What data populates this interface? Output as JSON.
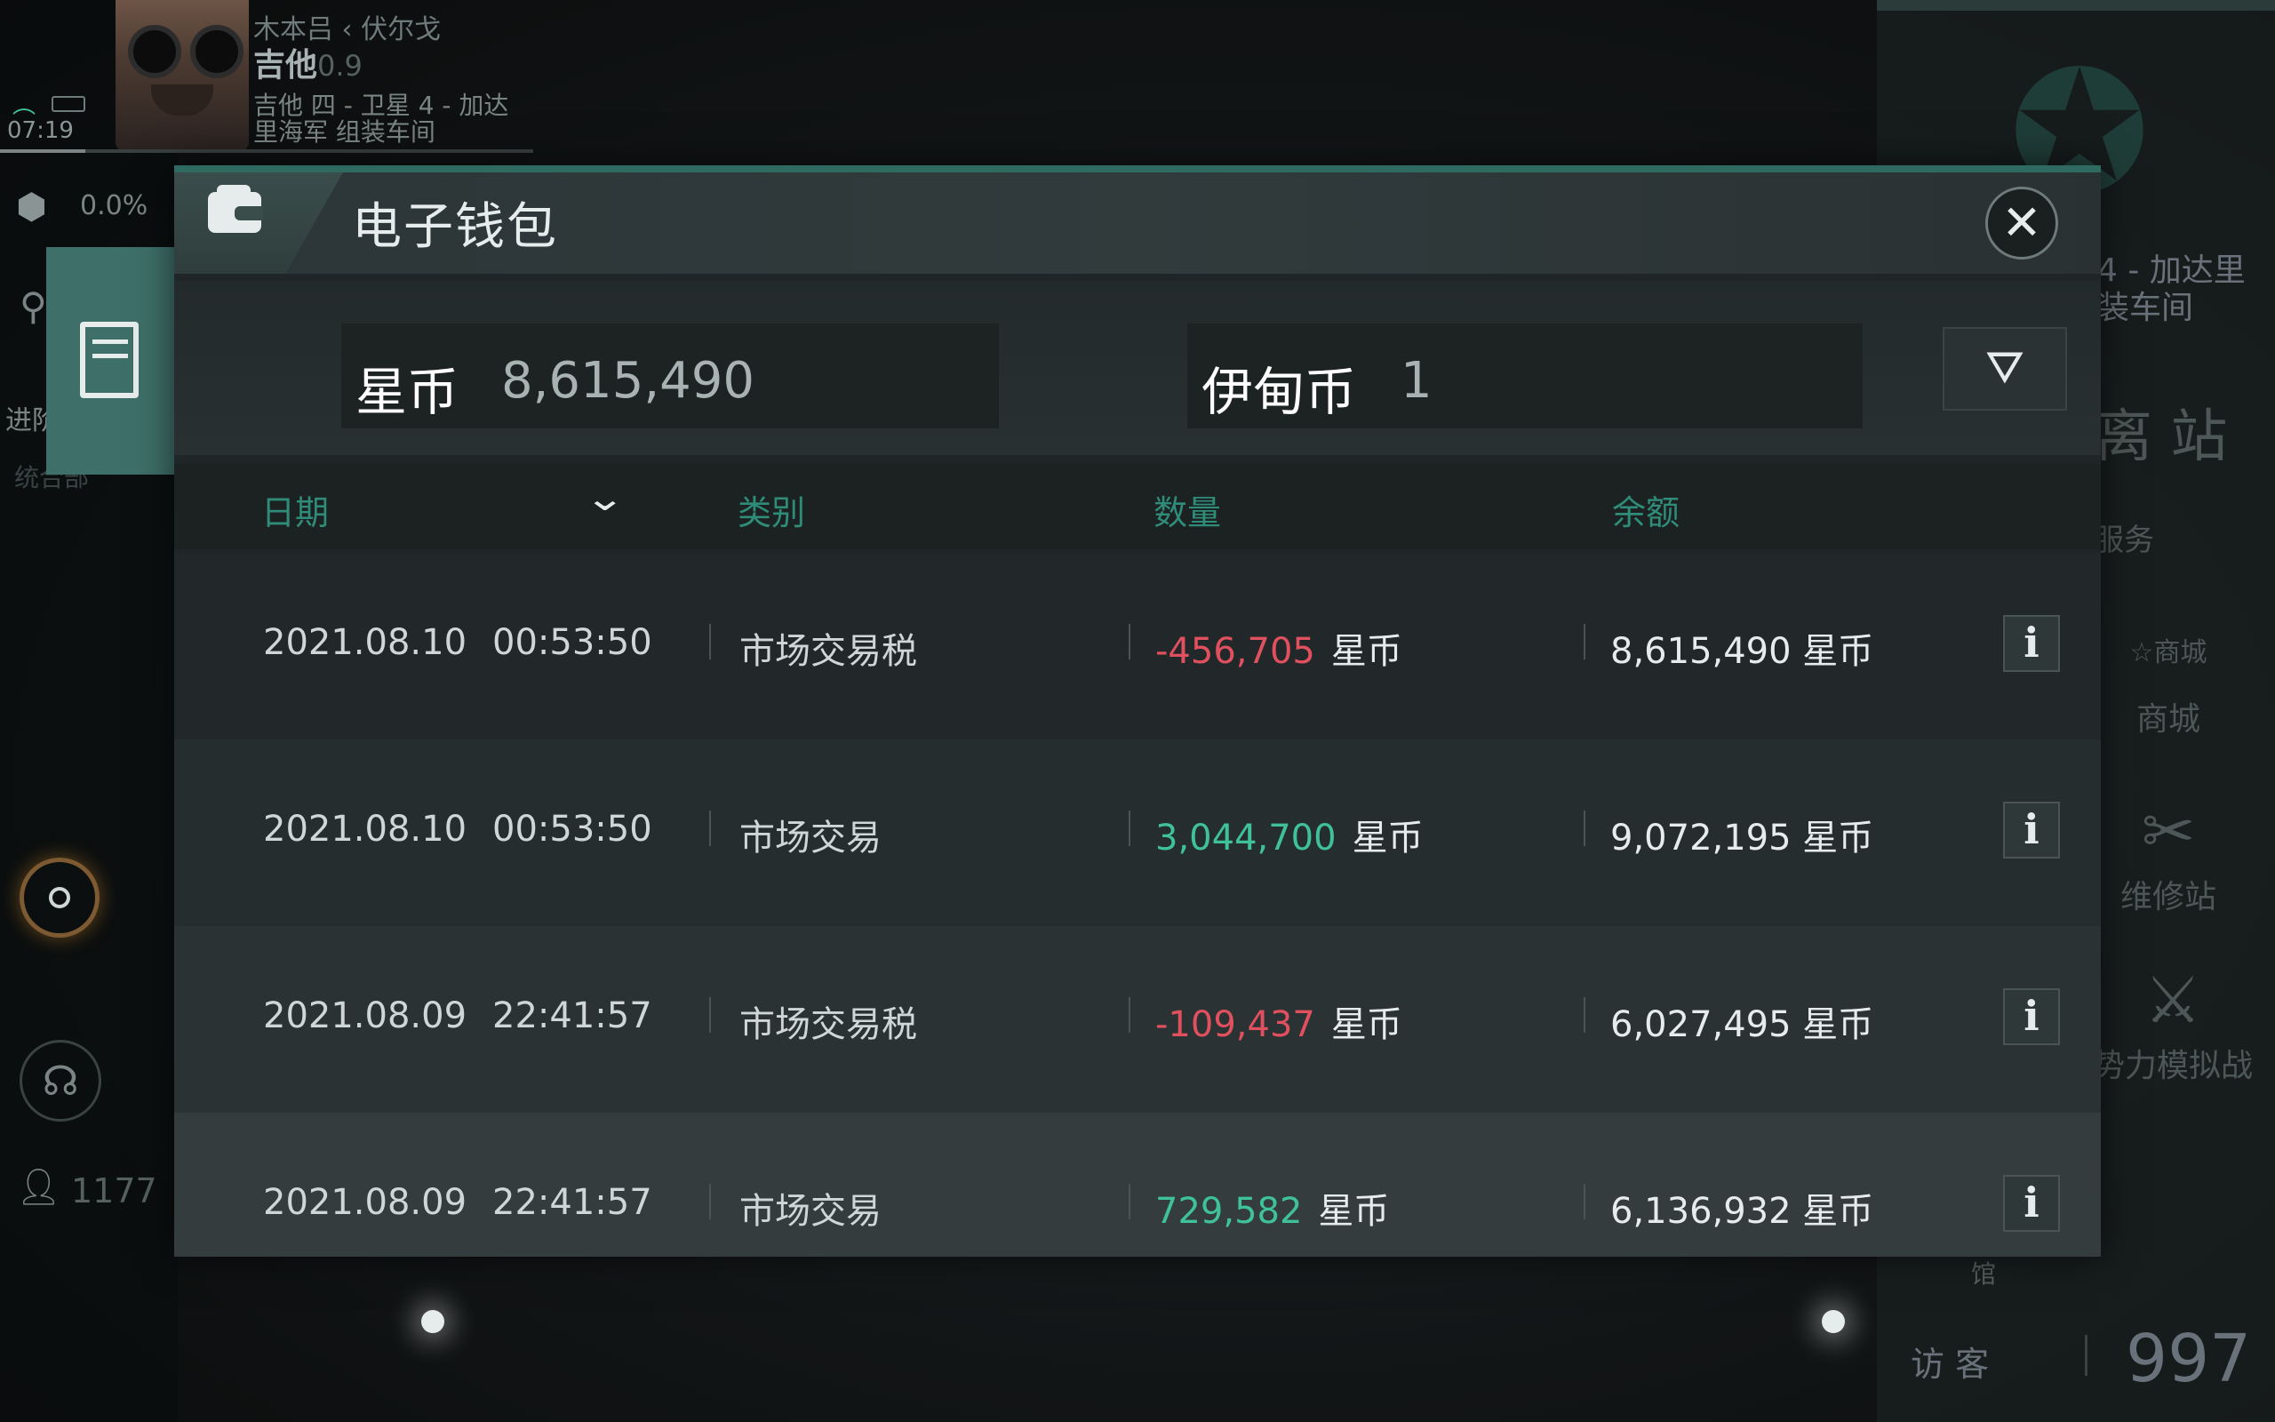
{
  "hud": {
    "time": "07:19",
    "region_route": "木本吕 ‹ 伏尔戈",
    "system": "吉他",
    "security": "0.9",
    "station_lines": [
      "吉他 四 - 卫星 4 - 加达",
      "里海军 组装车间"
    ],
    "cargo_percent": "0.0%",
    "side_text_a": "进阶",
    "side_text_b": "统合部",
    "player_count": "1177"
  },
  "right_panel": {
    "station_lines": [
      "4 - 加达里",
      "装车间"
    ],
    "undock_label": "离 站",
    "services_label": "服务",
    "shop_icon_text": "商城",
    "shop_label": "商城",
    "repair_label": "维修站",
    "sim_label": "势力模拟战",
    "pavilion_label": "馆",
    "visitor_label": "访 客",
    "visitor_count": "997"
  },
  "wallet": {
    "title": "电子钱包",
    "star_coin_label": "星币",
    "star_coin_value": "8,615,490",
    "eden_coin_label": "伊甸币",
    "eden_coin_value": "1",
    "columns": {
      "date": "日期",
      "category": "类别",
      "amount": "数量",
      "balance": "余额"
    },
    "rows": [
      {
        "date": "2021.08.10",
        "time": "00:53:50",
        "category": "市场交易税",
        "amount": "-456,705",
        "amount_unit": "星币",
        "balance": "8,615,490 星币",
        "sign": "negative"
      },
      {
        "date": "2021.08.10",
        "time": "00:53:50",
        "category": "市场交易",
        "amount": "3,044,700",
        "amount_unit": "星币",
        "balance": "9,072,195 星币",
        "sign": "positive"
      },
      {
        "date": "2021.08.09",
        "time": "22:41:57",
        "category": "市场交易税",
        "amount": "-109,437",
        "amount_unit": "星币",
        "balance": "6,027,495 星币",
        "sign": "negative"
      },
      {
        "date": "2021.08.09",
        "time": "22:41:57",
        "category": "市场交易",
        "amount": "729,582",
        "amount_unit": "星币",
        "balance": "6,136,932 星币",
        "sign": "positive"
      }
    ],
    "info_glyph": "i"
  },
  "colors": {
    "accent": "#2f8c79",
    "positive": "#3fc29a",
    "negative": "#e0505e",
    "panel": "#202628"
  },
  "icons": [
    "wallet-icon",
    "close-icon",
    "filter-icon",
    "chevron-down-icon",
    "info-icon",
    "notes-icon",
    "cargo-icon",
    "map-pin-icon",
    "target-icon",
    "headset-icon",
    "player-icon",
    "shop-icon",
    "repair-icon",
    "sim-icon",
    "emblem-icon",
    "wifi-icon",
    "battery-icon"
  ]
}
